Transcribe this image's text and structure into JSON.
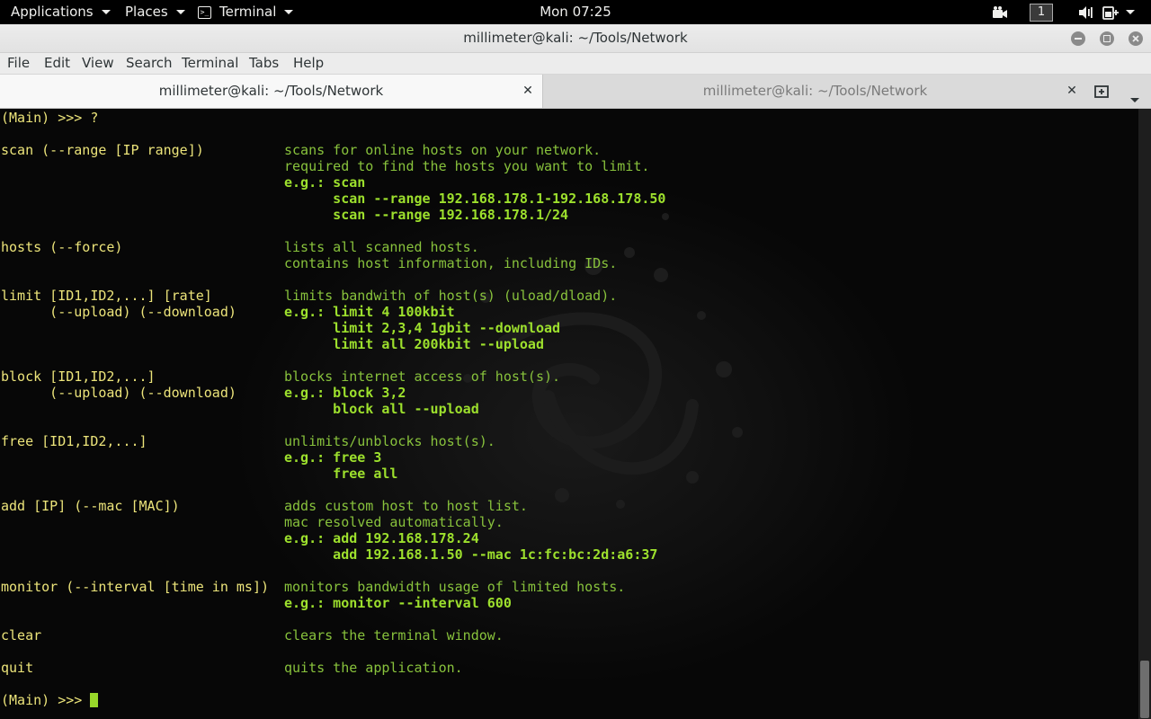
{
  "topbar": {
    "applications": "Applications",
    "places": "Places",
    "terminal": "Terminal",
    "clock": "Mon 07:25",
    "workspace": "1"
  },
  "window": {
    "title": "millimeter@kali: ~/Tools/Network"
  },
  "menubar": {
    "items": [
      "File",
      "Edit",
      "View",
      "Search",
      "Terminal",
      "Tabs",
      "Help"
    ]
  },
  "tabs": [
    {
      "label": "millimeter@kali: ~/Tools/Network",
      "active": true
    },
    {
      "label": "millimeter@kali: ~/Tools/Network",
      "active": false
    }
  ],
  "terminal": {
    "prompt_top": "(Main) >>> ?",
    "prompt_bottom": "(Main) >>> ",
    "lines": [
      {
        "cmd": "scan (--range [IP range])",
        "desc": "scans for online hosts on your network."
      },
      {
        "cmd": "",
        "desc": "required to find the hosts you want to limit."
      },
      {
        "cmd": "",
        "desc": "e.g.: scan",
        "example": true
      },
      {
        "cmd": "",
        "desc": "      scan --range 192.168.178.1-192.168.178.50",
        "example": true
      },
      {
        "cmd": "",
        "desc": "      scan --range 192.168.178.1/24",
        "example": true
      },
      {
        "cmd": "hosts (--force)",
        "desc": "lists all scanned hosts."
      },
      {
        "cmd": "",
        "desc": "contains host information, including IDs."
      },
      {
        "cmd": "limit [ID1,ID2,...] [rate]",
        "desc": "limits bandwith of host(s) (uload/dload)."
      },
      {
        "cmd": "      (--upload) (--download)",
        "desc": "e.g.: limit 4 100kbit",
        "example": true
      },
      {
        "cmd": "",
        "desc": "      limit 2,3,4 1gbit --download",
        "example": true
      },
      {
        "cmd": "",
        "desc": "      limit all 200kbit --upload",
        "example": true
      },
      {
        "cmd": "block [ID1,ID2,...]",
        "desc": "blocks internet access of host(s)."
      },
      {
        "cmd": "      (--upload) (--download)",
        "desc": "e.g.: block 3,2",
        "example": true
      },
      {
        "cmd": "",
        "desc": "      block all --upload",
        "example": true
      },
      {
        "cmd": "free [ID1,ID2,...]",
        "desc": "unlimits/unblocks host(s)."
      },
      {
        "cmd": "",
        "desc": "e.g.: free 3",
        "example": true
      },
      {
        "cmd": "",
        "desc": "      free all",
        "example": true
      },
      {
        "cmd": "add [IP] (--mac [MAC])",
        "desc": "adds custom host to host list."
      },
      {
        "cmd": "",
        "desc": "mac resolved automatically."
      },
      {
        "cmd": "",
        "desc": "e.g.: add 192.168.178.24",
        "example": true
      },
      {
        "cmd": "",
        "desc": "      add 192.168.1.50 --mac 1c:fc:bc:2d:a6:37",
        "example": true
      },
      {
        "cmd": "monitor (--interval [time in ms])",
        "desc": "monitors bandwidth usage of limited hosts."
      },
      {
        "cmd": "",
        "desc": "e.g.: monitor --interval 600",
        "example": true
      },
      {
        "cmd": "clear",
        "desc": "clears the terminal window."
      },
      {
        "cmd": "quit",
        "desc": "quits the application."
      }
    ]
  },
  "colors": {
    "command": "#ece47a",
    "description": "#88c23c",
    "example": "#9de02d",
    "cursor": "#98d82a"
  }
}
